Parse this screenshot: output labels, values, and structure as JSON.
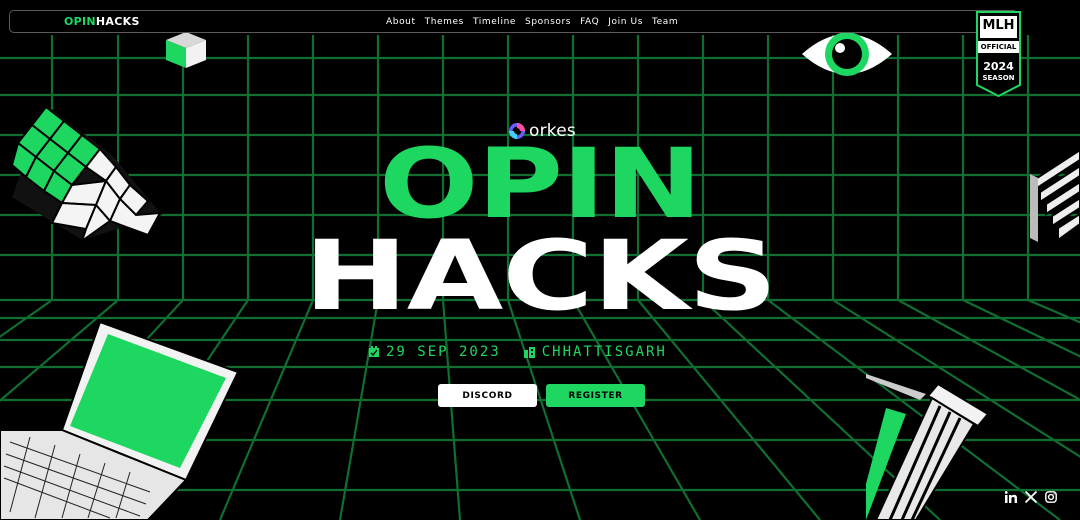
{
  "brand": {
    "logo_part1": "OPIN",
    "logo_part2": "HACKS"
  },
  "nav": {
    "items": [
      "About",
      "Themes",
      "Timeline",
      "Sponsors",
      "FAQ",
      "Join Us",
      "Team"
    ]
  },
  "badge": {
    "top": "MLH",
    "middle": "OFFICIAL",
    "year": "2024",
    "bottom": "SEASON"
  },
  "sponsor": {
    "name": "orkes"
  },
  "hero": {
    "title_line1": "OPIN",
    "title_line2": "HACKS",
    "date": "29 SEP 2023",
    "location": "CHHATTISGARH"
  },
  "buttons": {
    "discord": "DISCORD",
    "register": "REGISTER"
  },
  "social": [
    "linkedin-icon",
    "x-icon",
    "instagram-icon"
  ],
  "colors": {
    "accent": "#1ed760",
    "background": "#000000",
    "grid": "#0e6b2e"
  }
}
